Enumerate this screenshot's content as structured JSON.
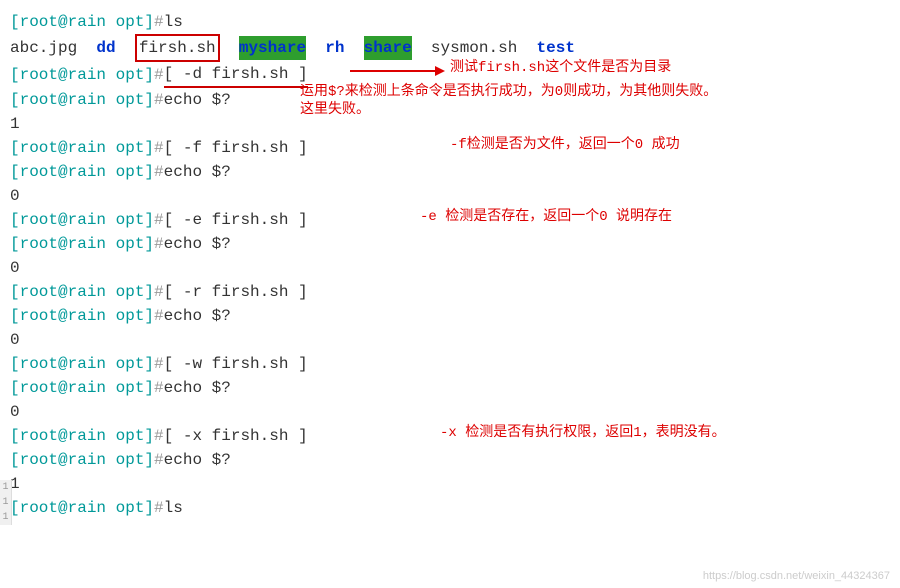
{
  "prompt": "[root@rain opt]",
  "hash": "#",
  "commands": {
    "ls": "ls",
    "test_d": "[ -d firsh.sh ]",
    "test_f": "[ -f firsh.sh ]",
    "test_e": "[ -e firsh.sh ]",
    "test_r": "[ -r firsh.sh ]",
    "test_w": "[ -w firsh.sh ]",
    "test_x": "[ -x firsh.sh ]",
    "echo": "echo $?",
    "ls2": "ls"
  },
  "ls_output": {
    "abc": "abc.jpg",
    "dd": "dd",
    "firsh": "firsh.sh",
    "myshare": "myshare",
    "rh": "rh",
    "share": "share",
    "sysmon": "sysmon.sh",
    "test": "test"
  },
  "outputs": {
    "r1": "1",
    "r2": "0",
    "r3": "0",
    "r4": "0",
    "r5": "0",
    "r6": "1"
  },
  "annotations": {
    "a1": "测试firsh.sh这个文件是否为目录",
    "a2": "运用$?来检测上条命令是否执行成功，为0则成功，为其他则失败。",
    "a2b": "这里失败。",
    "a3": "-f检测是否为文件，返回一个0 成功",
    "a4": "-e 检测是否存在，返回一个0 说明存在",
    "a5": "-x 检测是否有执行权限，返回1，表明没有。"
  },
  "watermark": "https://blog.csdn.net/weixin_44324367",
  "gutter": {
    "g1": "1",
    "g2": "1",
    "g3": "1"
  }
}
